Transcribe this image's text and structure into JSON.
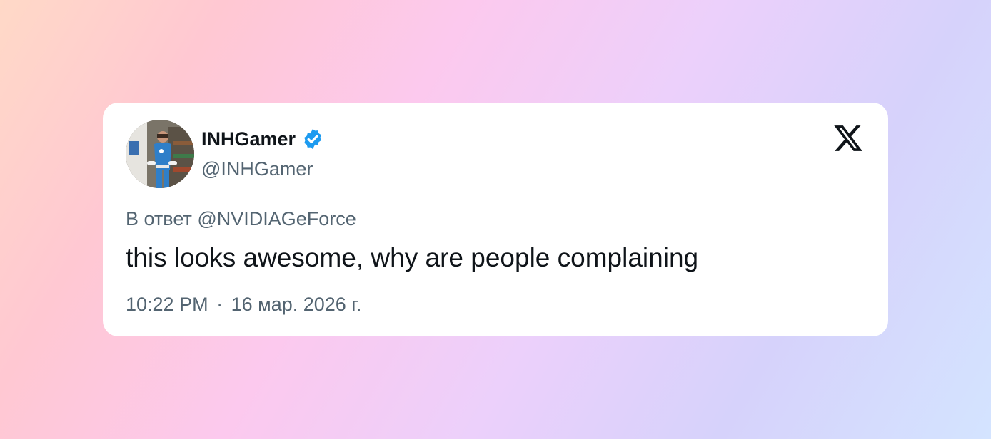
{
  "tweet": {
    "display_name": "INHGamer",
    "handle": "@INHGamer",
    "verified": true,
    "reply_to": "В ответ @NVIDIAGeForce",
    "text": "this looks awesome, why are people complaining",
    "time": "10:22 PM",
    "separator": "·",
    "date": "16 мар. 2026 г."
  },
  "icons": {
    "avatar": "avatar-photo",
    "verified": "verified-badge-icon",
    "brand": "x-logo-icon"
  },
  "colors": {
    "verified_blue": "#1d9bf0",
    "text_primary": "#0f1419",
    "text_secondary": "#536471",
    "card_background": "#ffffff"
  }
}
